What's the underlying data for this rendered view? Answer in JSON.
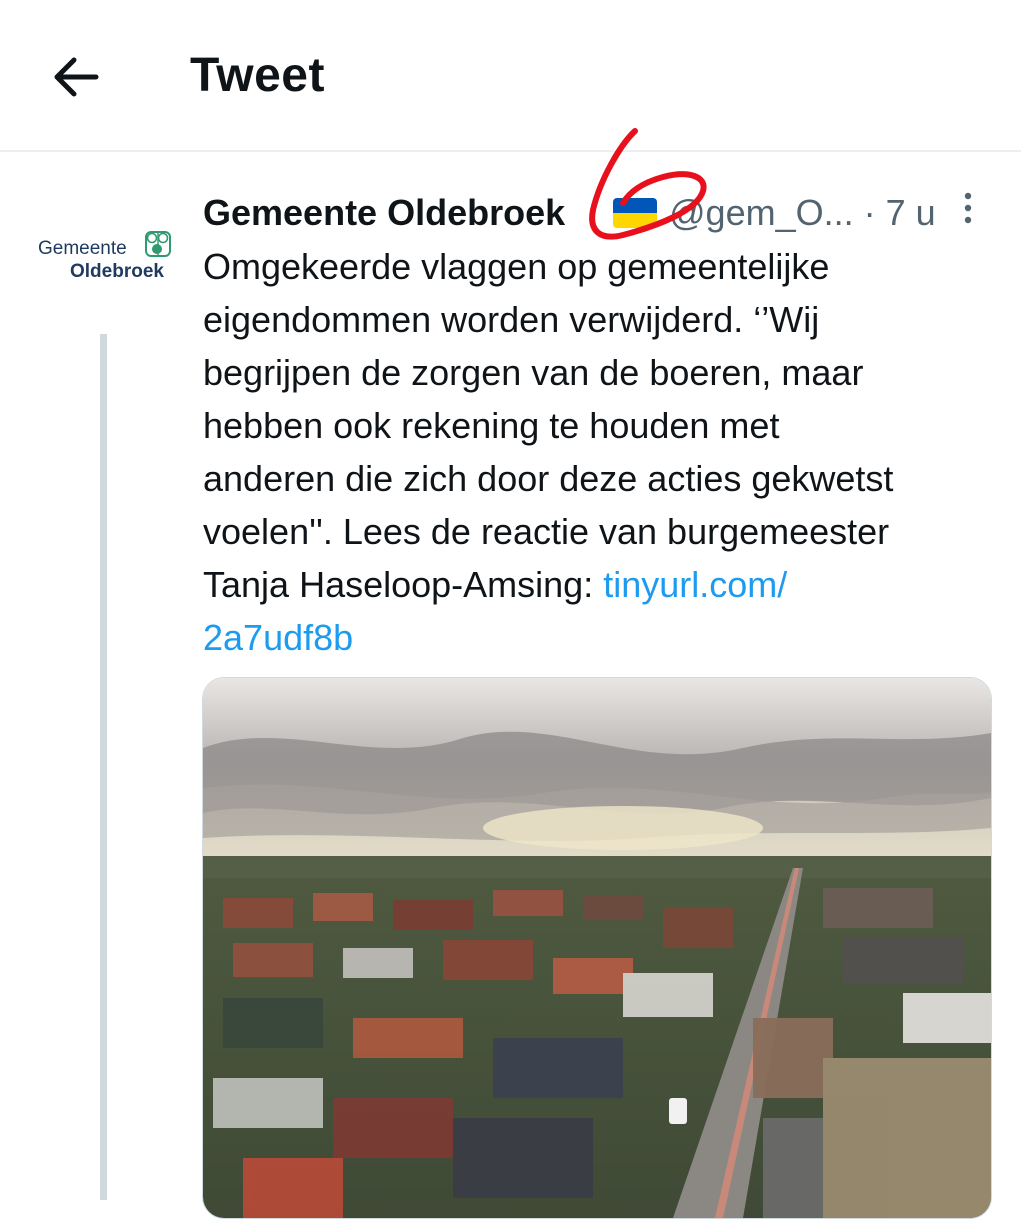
{
  "header": {
    "title": "Tweet"
  },
  "tweet": {
    "avatar": {
      "line1": "Gemeente",
      "line2": "Oldebroek"
    },
    "author_name": "Gemeente Oldebroek",
    "handle_time": "@gem_O... · 7 u",
    "text_lines": [
      "Omgekeerde vlaggen op gemeentelijke",
      "eigendommen worden verwijderd. ‘’Wij",
      "begrijpen de zorgen van de boeren, maar",
      "hebben ook rekening te houden met",
      "anderen die zich door deze acties gekwetst",
      "voelen''. Lees de reactie van burgemeester"
    ],
    "text_last_prefix": "Tanja Haseloop-Amsing: ",
    "link_part1": "tinyurl.com/",
    "link_part2": "2a7udf8b"
  },
  "annotation": {
    "mark": "6"
  },
  "colors": {
    "link": "#1d9bf0",
    "flag_blue": "#0057b7",
    "flag_yellow": "#ffd700",
    "annotation_red": "#e8101c",
    "logo_green": "#2e9a6e",
    "logo_navy": "#1f3a5f"
  },
  "icons": {
    "back": "arrow-left-icon",
    "more": "more-vertical-icon"
  }
}
